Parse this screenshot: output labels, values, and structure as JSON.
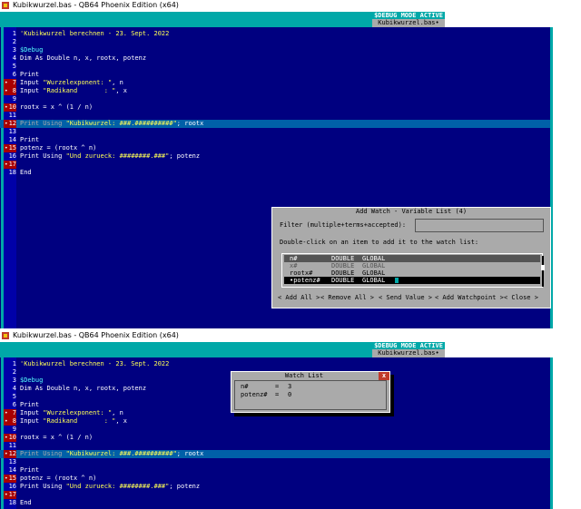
{
  "window_title": "Kubikwurzel.bas - QB64 Phoenix Edition (x64)",
  "debug_banner": "$DEBUG MODE ACTIVE",
  "file_tab": "Kubikwurzel.bas•",
  "code_lines": [
    {
      "num": "1",
      "segments": [
        {
          "t": "'Kubikwurzel berechnen - 23. Sept. 2022",
          "c": "str"
        }
      ]
    },
    {
      "num": "2",
      "segments": []
    },
    {
      "num": "3",
      "segments": [
        {
          "t": "$Debug",
          "c": "meta"
        }
      ]
    },
    {
      "num": "4",
      "segments": [
        {
          "t": "Dim As Double n, x, rootx, potenz",
          "c": "kw"
        }
      ]
    },
    {
      "num": "5",
      "segments": []
    },
    {
      "num": "6",
      "segments": [
        {
          "t": "Print",
          "c": "kw"
        }
      ]
    },
    {
      "num": "7",
      "bp": true,
      "segments": [
        {
          "t": "Input ",
          "c": "kw"
        },
        {
          "t": "\"Wurzelexponent: \"",
          "c": "str"
        },
        {
          "t": ", n",
          "c": "kw"
        }
      ]
    },
    {
      "num": "8",
      "bp": true,
      "segments": [
        {
          "t": "Input ",
          "c": "kw"
        },
        {
          "t": "\"Radikand       : \"",
          "c": "str"
        },
        {
          "t": ", x",
          "c": "kw"
        }
      ]
    },
    {
      "num": "9",
      "segments": []
    },
    {
      "num": "10",
      "bp": true,
      "segments": [
        {
          "t": "rootx = x ^ (1 / n)",
          "c": "kw"
        }
      ]
    },
    {
      "num": "11",
      "segments": []
    },
    {
      "num": "12",
      "bp": true,
      "exec": true,
      "segments": [
        {
          "t": "Print Using ",
          "c": "dim"
        },
        {
          "t": "\"Kubikwurzel: ###.##########\"",
          "c": "str"
        },
        {
          "t": "; rootx",
          "c": "kw"
        }
      ]
    },
    {
      "num": "13",
      "segments": []
    },
    {
      "num": "14",
      "segments": [
        {
          "t": "Print",
          "c": "kw"
        }
      ]
    },
    {
      "num": "15",
      "bp": true,
      "segments": [
        {
          "t": "potenz = (rootx ^ n)",
          "c": "kw"
        }
      ]
    },
    {
      "num": "16",
      "segments": [
        {
          "t": "Print Using ",
          "c": "kw"
        },
        {
          "t": "\"Und zurueck: ########.###\"",
          "c": "str"
        },
        {
          "t": "; potenz",
          "c": "kw"
        }
      ]
    },
    {
      "num": "17",
      "bp": true,
      "segments": []
    },
    {
      "num": "18",
      "segments": [
        {
          "t": "End",
          "c": "kw"
        }
      ]
    }
  ],
  "dialog": {
    "title": "Add Watch - Variable List (4)",
    "filter_label": "Filter (multiple+terms+accepted):",
    "filter_value": "",
    "instruction": "Double-click on an item to add it to the watch list:",
    "variables": [
      {
        "name": "n#",
        "type": "DOUBLE",
        "scope": "GLOBAL",
        "state": "hl"
      },
      {
        "name": "x#",
        "type": "DOUBLE",
        "scope": "GLOBAL",
        "state": "normal"
      },
      {
        "name": "rootx#",
        "type": "DOUBLE",
        "scope": "GLOBAL",
        "state": "act"
      },
      {
        "name": "•potenz#",
        "type": "DOUBLE",
        "scope": "GLOBAL",
        "state": "sel"
      }
    ],
    "buttons": [
      "< Add All >",
      "< Remove All >",
      "< Send Value >",
      "< Add Watchpoint >",
      "< Close >"
    ]
  },
  "watch": {
    "title": "Watch List",
    "close_label": "x",
    "items": [
      {
        "name": "n#",
        "eq": "=",
        "value": "3"
      },
      {
        "name": "potenz#",
        "eq": "=",
        "value": "0"
      }
    ]
  },
  "colors": {
    "editor_bg": "#000080",
    "header": "#00a8a8",
    "breakpoint": "#a80000",
    "exec_line": "#0060a8",
    "dialog_bg": "#aaaaaa"
  }
}
